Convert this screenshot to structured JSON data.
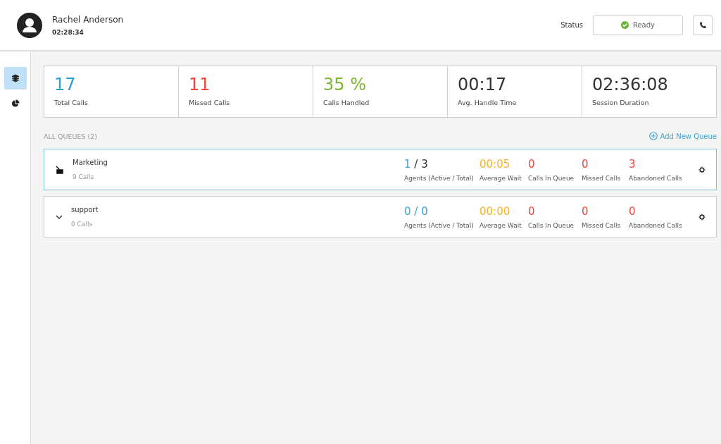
{
  "header": {
    "name": "Rachel Anderson",
    "timer": "02:28:34",
    "status_label": "Status",
    "status": "Ready"
  },
  "sidebar": {
    "items": [
      {
        "kind": "layers",
        "selected": true
      },
      {
        "kind": "chart",
        "selected": false
      }
    ]
  },
  "stats": [
    {
      "value": "17",
      "label": "Total Calls",
      "color": "#2a9fd0"
    },
    {
      "value": "11",
      "label": "Missed Calls",
      "color": "#f04438"
    },
    {
      "value": "35 %",
      "label": "Calls Handled",
      "color": "#7cb82f"
    },
    {
      "value": "00:17",
      "label": "Avg. Handle Time",
      "color": "#333333"
    },
    {
      "value": "02:36:08",
      "label": "Session Duration",
      "color": "#333333"
    }
  ],
  "queues_heading": "ALL QUEUES (2)",
  "add_queue": "Add New Queue",
  "queues": [
    {
      "name": "Marketing",
      "calls": "9 Calls",
      "selected": true,
      "agents_active": "1",
      "agents_total": {
        "text": "/ 3",
        "color": "#333333"
      },
      "agents_label": "Agents (Active / Total)",
      "wait": "00:05",
      "wait_label": "Average Wait",
      "in_queue": "0",
      "in_queue_label": "Calls In Queue",
      "missed": "0",
      "missed_label": "Missed Calls",
      "abandoned": "3",
      "abandoned_label": "Abandoned Calls"
    },
    {
      "name": "support",
      "calls": "0 Calls",
      "selected": false,
      "agents_active": "0",
      "agents_total": {
        "text": "/ 0",
        "color": "#3aa3d3"
      },
      "agents_label": "Agents (Active / Total)",
      "wait": "00:00",
      "wait_label": "Average Wait",
      "in_queue": "0",
      "in_queue_label": "Calls In Queue",
      "missed": "0",
      "missed_label": "Missed Calls",
      "abandoned": "0",
      "abandoned_label": "Abandoned Calls"
    }
  ]
}
